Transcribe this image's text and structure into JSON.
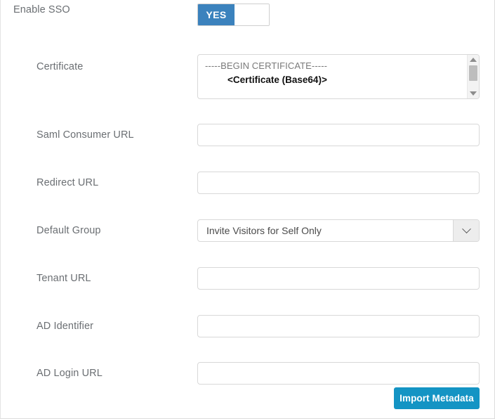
{
  "form": {
    "sso_toggle": {
      "label": "Enable SSO",
      "state_label": "YES",
      "on_color": "#3b82bd"
    },
    "rows": [
      {
        "label": "Certificate",
        "type": "textarea",
        "placeholder_line1": "-----BEGIN CERTIFICATE-----",
        "placeholder_line2": "<Certificate (Base64)>",
        "value": ""
      },
      {
        "label": "Saml Consumer URL",
        "type": "text",
        "value": "",
        "placeholder": ""
      },
      {
        "label": "Redirect URL",
        "type": "text",
        "value": "",
        "placeholder": ""
      },
      {
        "label": "Default Group",
        "type": "select",
        "value": "Invite Visitors for Self Only"
      },
      {
        "label": "Tenant URL",
        "type": "text",
        "value": "",
        "placeholder": ""
      },
      {
        "label": "AD Identifier",
        "type": "text",
        "value": "",
        "placeholder": ""
      },
      {
        "label": "AD Login URL",
        "type": "text",
        "value": "",
        "placeholder": "",
        "focused": true
      }
    ],
    "import_button": {
      "label": "Import Metadata",
      "color": "#1494c4"
    }
  }
}
